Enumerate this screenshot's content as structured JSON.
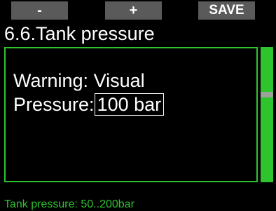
{
  "softkeys": {
    "left": "-",
    "middle": "+",
    "right": "SAVE",
    "background": "#5a5a5a"
  },
  "screen": {
    "title": "6.6.Tank pressure"
  },
  "settings": {
    "warning_label": "Warning:",
    "warning_value": "Visual",
    "pressure_label": "Pressure:",
    "pressure_value": "100 bar"
  },
  "scrollbar": {
    "color": "#2ec42e"
  },
  "hint": {
    "text": "Tank pressure: 50..200bar",
    "color": "#2ec42e"
  }
}
